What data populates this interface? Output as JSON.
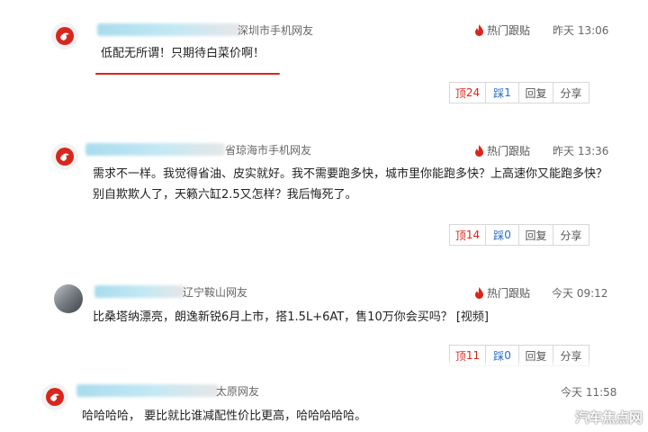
{
  "comments": [
    {
      "location": "深圳市手机网友",
      "hot_label": "热门跟贴",
      "time": "昨天 13:06",
      "text": "低配无所谓！只期待白菜价啊！",
      "up_label": "顶",
      "up_count": "24",
      "down_label": "踩",
      "down_count": "1",
      "reply_label": "回复",
      "share_label": "分享"
    },
    {
      "location": "省琼海市手机网友",
      "hot_label": "热门跟贴",
      "time": "昨天 13:36",
      "text": "需求不一样。我觉得省油、皮实就好。我不需要跑多快，城市里你能跑多快？上高速你又能跑多快？别自欺欺人了，天籁六缸2.5又怎样？我后悔死了。",
      "up_label": "顶",
      "up_count": "14",
      "down_label": "踩",
      "down_count": "0",
      "reply_label": "回复",
      "share_label": "分享"
    },
    {
      "location": "辽宁鞍山网友",
      "hot_label": "热门跟贴",
      "time": "今天 09:12",
      "text": "比桑塔纳漂亮，朗逸新锐6月上市，搭1.5L+6AT，售10万你会买吗？ [视频]",
      "up_label": "顶",
      "up_count": "11",
      "down_label": "踩",
      "down_count": "0",
      "reply_label": "回复",
      "share_label": "分享"
    },
    {
      "location": "太原网友",
      "time": "今天 11:58",
      "text": "哈哈哈哈， 要比就比谁减配性价比更高，哈哈哈哈哈。"
    }
  ],
  "watermark": "汽车焦点网",
  "colors": {
    "accent_red": "#d9261c",
    "link_blue": "#2b6fc2",
    "border": "#d8d8d8"
  },
  "icons": {
    "avatar": "netease-logo-icon",
    "hot": "flame-icon",
    "watermark": "weibo-icon"
  }
}
